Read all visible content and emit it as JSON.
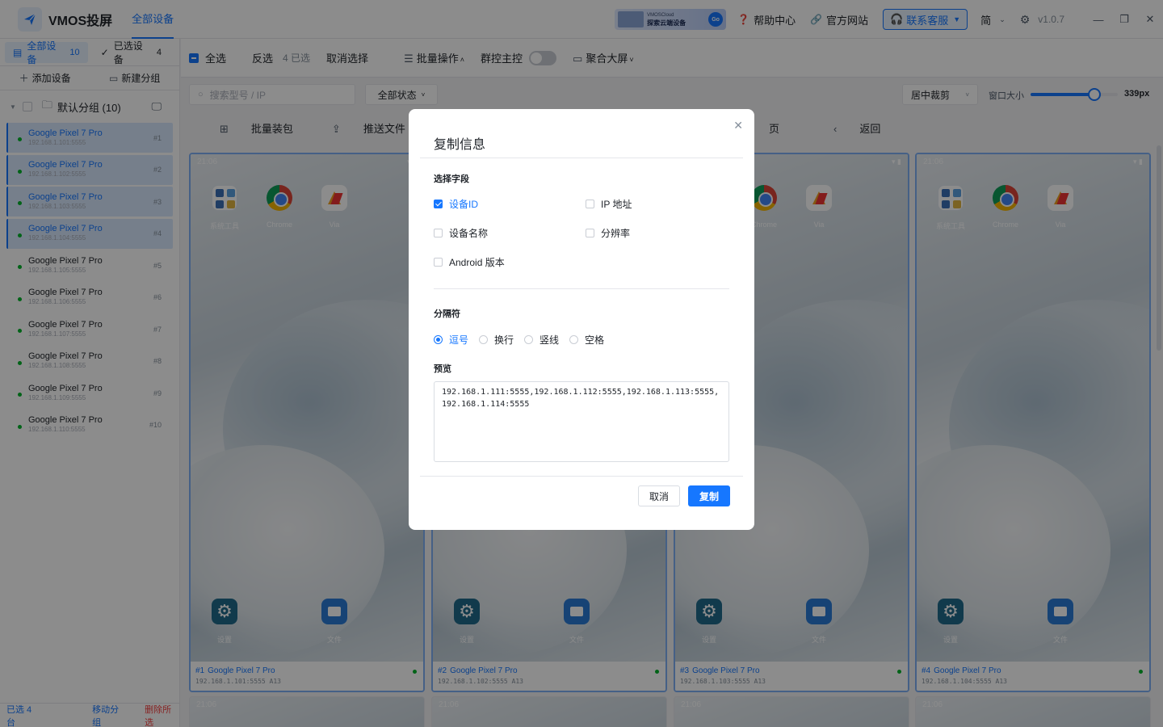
{
  "header": {
    "app_title": "VMOS投屏",
    "tab_all": "全部设备",
    "cloud_small": "VMOSCloud",
    "cloud_big": "探索云端设备",
    "cloud_go": "Go",
    "help": "帮助中心",
    "website": "官方网站",
    "service": "联系客服",
    "lang": "简",
    "version": "v1.0.7"
  },
  "sidebar": {
    "tab_all_label": "全部设备",
    "tab_all_count": "10",
    "tab_selected_label": "已选设备",
    "tab_selected_count": "4",
    "add_device": "添加设备",
    "new_group": "新建分组",
    "group_name": "默认分组 (10)",
    "devices": [
      {
        "name": "Google Pixel 7 Pro",
        "ip": "192.168.1.101:5555",
        "num": "#1"
      },
      {
        "name": "Google Pixel 7 Pro",
        "ip": "192.168.1.102:5555",
        "num": "#2"
      },
      {
        "name": "Google Pixel 7 Pro",
        "ip": "192.168.1.103:5555",
        "num": "#3"
      },
      {
        "name": "Google Pixel 7 Pro",
        "ip": "192.168.1.104:5555",
        "num": "#4"
      },
      {
        "name": "Google Pixel 7 Pro",
        "ip": "192.168.1.105:5555",
        "num": "#5"
      },
      {
        "name": "Google Pixel 7 Pro",
        "ip": "192.168.1.106:5555",
        "num": "#6"
      },
      {
        "name": "Google Pixel 7 Pro",
        "ip": "192.168.1.107:5555",
        "num": "#7"
      },
      {
        "name": "Google Pixel 7 Pro",
        "ip": "192.168.1.108:5555",
        "num": "#8"
      },
      {
        "name": "Google Pixel 7 Pro",
        "ip": "192.168.1.109:5555",
        "num": "#9"
      },
      {
        "name": "Google Pixel 7 Pro",
        "ip": "192.168.1.110:5555",
        "num": "#10"
      }
    ],
    "footer_selected": "已选 4 台",
    "footer_move": "移动分组",
    "footer_delete": "删除所选"
  },
  "toolbar": {
    "select_all": "全选",
    "invert": "反选",
    "selected_count": "4 已选",
    "cancel_select": "取消选择",
    "batch_ops": "批量操作",
    "group_control": "群控主控",
    "big_screen": "聚合大屏",
    "search_placeholder": "搜索型号 / IP",
    "status_filter": "全部状态",
    "crop_mode": "居中裁剪",
    "window_size_label": "窗口大小",
    "window_size_value": "339px",
    "window_size_fraction": 0.73,
    "batch_install": "批量装包",
    "push_file": "推送文件",
    "batch_partial": "批量",
    "partial_tail": "页",
    "back": "返回"
  },
  "cards": [
    {
      "num": "#1",
      "name": "Google Pixel 7 Pro",
      "ip": "192.168.1.101:5555  A13"
    },
    {
      "num": "#2",
      "name": "Google Pixel 7 Pro",
      "ip": "192.168.1.102:5555  A13"
    },
    {
      "num": "#3",
      "name": "Google Pixel 7 Pro",
      "ip": "192.168.1.103:5555  A13"
    },
    {
      "num": "#4",
      "name": "Google Pixel 7 Pro",
      "ip": "192.168.1.104:5555  A13"
    }
  ],
  "phone": {
    "time": "21:06",
    "apps": {
      "tools": "系统工具",
      "chrome": "Chrome",
      "via": "Via",
      "settings": "设置",
      "files": "文件"
    }
  },
  "modal": {
    "title": "复制信息",
    "fields_label": "选择字段",
    "fields": {
      "device_id": "设备ID",
      "ip": "IP 地址",
      "device_name": "设备名称",
      "resolution": "分辨率",
      "android": "Android 版本"
    },
    "separator_label": "分隔符",
    "separators": {
      "comma": "逗号",
      "newline": "换行",
      "pipe": "竖线",
      "space": "空格"
    },
    "preview_label": "预览",
    "preview_text": "192.168.1.111:5555,192.168.1.112:5555,192.168.1.113:5555,192.168.1.114:5555",
    "cancel": "取消",
    "copy": "复制"
  },
  "colors": {
    "accent": "#1677ff",
    "online": "#00b42a",
    "danger": "#f53f3f"
  }
}
